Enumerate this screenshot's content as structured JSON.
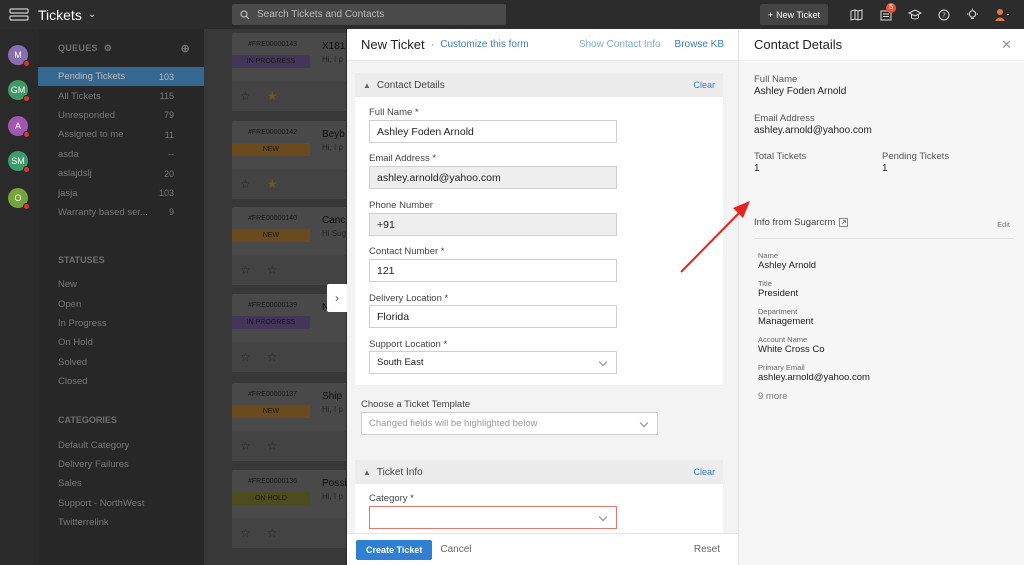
{
  "topbar": {
    "app_title": "Tickets",
    "search_placeholder": "Search Tickets and Contacts",
    "new_ticket_label": "New Ticket",
    "notification_count": "5"
  },
  "rail": {
    "avatars": [
      {
        "initials": "M",
        "color": "#8a6fb0"
      },
      {
        "initials": "GM",
        "color": "#3e9a64"
      },
      {
        "initials": "A",
        "color": "#a057b0"
      },
      {
        "initials": "SM",
        "color": "#3d9c6b"
      },
      {
        "initials": "O",
        "color": "#74a43a"
      }
    ]
  },
  "sidebar": {
    "queues_label": "QUEUES",
    "queues": [
      {
        "label": "Pending Tickets",
        "count": "103"
      },
      {
        "label": "All Tickets",
        "count": "115"
      },
      {
        "label": "Unresponded",
        "count": "79"
      },
      {
        "label": "Assigned to me",
        "count": "11"
      },
      {
        "label": "asda",
        "count": "--"
      },
      {
        "label": "aslajdslj",
        "count": "20"
      },
      {
        "label": "jasja",
        "count": "103"
      },
      {
        "label": "Warranty based ser...",
        "count": "9"
      }
    ],
    "statuses_label": "STATUSES",
    "statuses": [
      "New",
      "Open",
      "In Progress",
      "On Hold",
      "Solved",
      "Closed"
    ],
    "categories_label": "CATEGORIES",
    "categories": [
      "Default Category",
      "Delivery Failures",
      "Sales",
      "Support - NorthWest",
      "Twitterrelink"
    ]
  },
  "tickets": [
    {
      "id": "#FRE00000143",
      "subject": "X181",
      "snippet": "Hi, I p",
      "status": "IN PROGRESS",
      "status_color": "#7b5aa6"
    },
    {
      "id": "#FRE00000142",
      "subject": "Beyb",
      "snippet": "Hi, I p",
      "status": "NEW",
      "status_color": "#c98a2d"
    },
    {
      "id": "#FRE00000140",
      "subject": "Canc",
      "snippet": "Hi Sug",
      "status": "NEW",
      "status_color": "#c98a2d"
    },
    {
      "id": "#FRE00000139",
      "subject": "N",
      "snippet": "",
      "status": "IN PROGRESS",
      "status_color": "#7b5aa6"
    },
    {
      "id": "#FRE00000137",
      "subject": "Ship",
      "snippet": "Hi, I p",
      "status": "NEW",
      "status_color": "#c98a2d"
    },
    {
      "id": "#FRE00000136",
      "subject": "Possi",
      "snippet": "Hi, I p",
      "status": "ON HOLD",
      "status_color": "#8a8a35"
    }
  ],
  "new_ticket": {
    "title": "New Ticket",
    "customize_link": "Customize this form",
    "show_contact_info": "Show Contact Info",
    "browse_kb": "Browse KB",
    "contact_section": "Contact Details",
    "clear": "Clear",
    "fields": {
      "full_name_label": "Full Name *",
      "full_name_value": "Ashley Foden Arnold",
      "email_label": "Email Address *",
      "email_value": "ashley.arnold@yahoo.com",
      "phone_label": "Phone Number",
      "phone_value": "+91",
      "contact_number_label": "Contact Number *",
      "contact_number_value": "121",
      "delivery_location_label": "Delivery Location *",
      "delivery_location_value": "Florida",
      "support_location_label": "Support Location *",
      "support_location_value": "South East"
    },
    "template_label": "Choose a Ticket Template",
    "template_placeholder": "Changed fields will be highlighted below",
    "ticket_info_section": "Ticket Info",
    "category_label": "Category *",
    "create_button": "Create Ticket",
    "cancel_button": "Cancel",
    "reset_button": "Reset"
  },
  "contact_details": {
    "title": "Contact Details",
    "full_name_label": "Full Name",
    "full_name_value": "Ashley Foden Arnold",
    "email_label": "Email Address",
    "email_value": "ashley.arnold@yahoo.com",
    "total_tickets_label": "Total Tickets",
    "total_tickets_value": "1",
    "pending_tickets_label": "Pending Tickets",
    "pending_tickets_value": "1",
    "info_from": "Info from Sugarcrm",
    "edit": "Edit",
    "sugar_fields": [
      {
        "label": "Name",
        "value": "Ashley Arnold"
      },
      {
        "label": "Title",
        "value": "President"
      },
      {
        "label": "Department",
        "value": "Management"
      },
      {
        "label": "Account Name",
        "value": "White Cross Co"
      },
      {
        "label": "Primary Email",
        "value": "ashley.arnold@yahoo.com"
      }
    ],
    "more": "9 more"
  },
  "colors": {
    "accent": "#2f7fd3",
    "active_queue": "#4a90c8",
    "annotation_arrow": "#e8231f"
  }
}
